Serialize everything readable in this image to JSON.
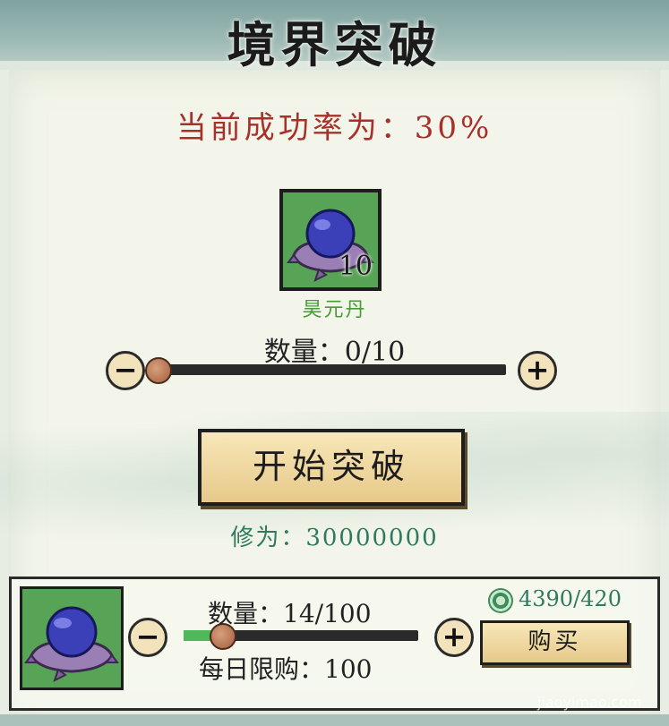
{
  "title": "境界突破",
  "success_rate": {
    "text": "当前成功率为：30%",
    "value_percent": 30
  },
  "pill_item": {
    "name": "昊元丹",
    "count": "10",
    "icon": "purple-orb-on-cushion-icon"
  },
  "quantity_selector": {
    "label": "数量：0/10",
    "current": 0,
    "max": 10,
    "minus_label": "−",
    "plus_label": "+"
  },
  "start_button": {
    "label": "开始突破"
  },
  "cultivation": {
    "text": "修为：30000000"
  },
  "shop": {
    "item_icon": "purple-orb-on-cushion-icon",
    "quantity_label": "数量：14/100",
    "quantity_current": 14,
    "quantity_max": 100,
    "daily_limit_label": "每日限购：100",
    "currency_icon": "jade-swirl-icon",
    "currency_text": "4390/420",
    "buy_label": "购买",
    "minus_label": "−",
    "plus_label": "+"
  },
  "watermark": "jiaoyimao.com",
  "colors": {
    "rate_red": "#a8302a",
    "item_name_green": "#4a9a3a",
    "cultivation_teal": "#2f7a5e",
    "slot_green": "#58a456",
    "button_gold": "#f2dca0"
  }
}
